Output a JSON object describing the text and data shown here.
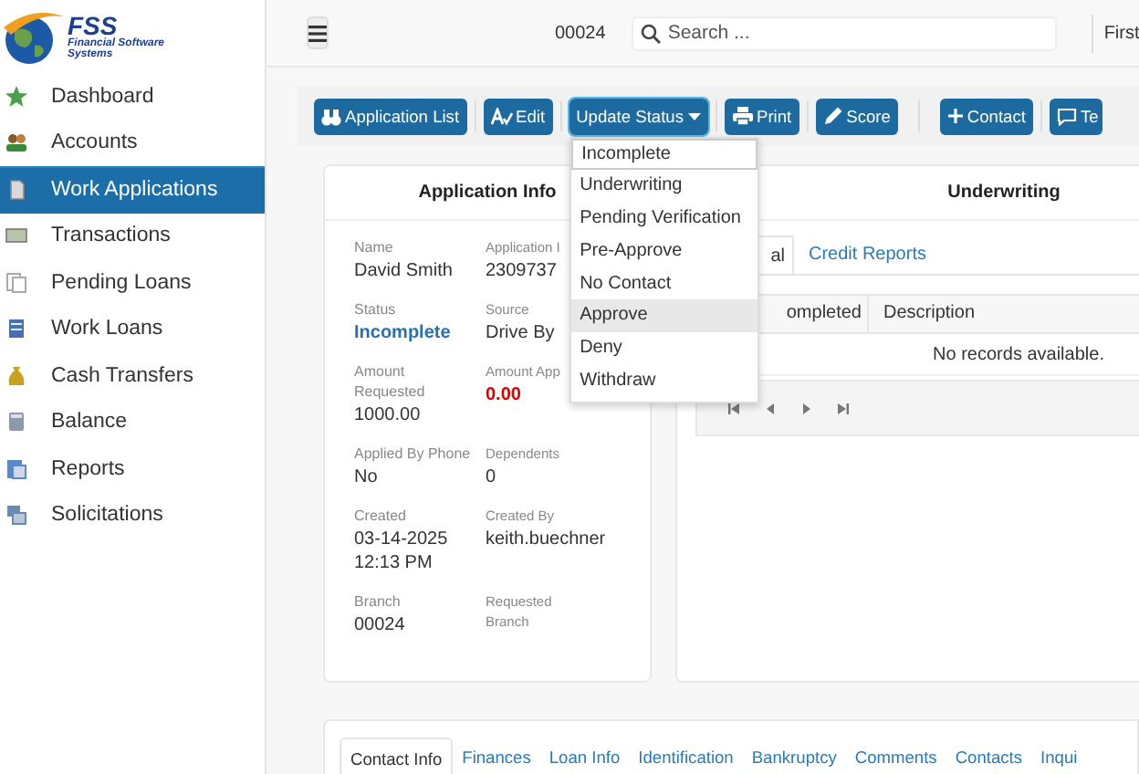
{
  "logo": {
    "title": "FSS",
    "subtitle": "Financial Software Systems"
  },
  "sidebar": {
    "items": [
      {
        "label": "Dashboard",
        "selected": false
      },
      {
        "label": "Accounts",
        "selected": false
      },
      {
        "label": "Work Applications",
        "selected": true
      },
      {
        "label": "Transactions",
        "selected": false
      },
      {
        "label": "Pending Loans",
        "selected": false
      },
      {
        "label": "Work Loans",
        "selected": false
      },
      {
        "label": "Cash Transfers",
        "selected": false
      },
      {
        "label": "Balance",
        "selected": false
      },
      {
        "label": "Reports",
        "selected": false
      },
      {
        "label": "Solicitations",
        "selected": false
      }
    ]
  },
  "top_bar": {
    "branch": "00024",
    "search": {
      "placeholder": "Search ..."
    },
    "user_field": "First"
  },
  "toolbar": {
    "buttons": [
      {
        "label": "Application List",
        "kind": "binoculars"
      },
      {
        "label": "Edit",
        "kind": "spell"
      },
      {
        "label": "Update Status",
        "kind": "dropdown"
      },
      {
        "label": "Print",
        "kind": "printer"
      },
      {
        "label": "Score",
        "kind": "pencil"
      },
      {
        "label": "Contact",
        "kind": "plus"
      },
      {
        "label": "Te",
        "kind": "message"
      }
    ]
  },
  "status_menu": {
    "items": [
      {
        "label": "Incomplete",
        "current": true,
        "highlighted": false
      },
      {
        "label": "Underwriting",
        "current": false,
        "highlighted": false
      },
      {
        "label": "Pending Verification",
        "current": false,
        "highlighted": false
      },
      {
        "label": "Pre-Approve",
        "current": false,
        "highlighted": false
      },
      {
        "label": "No Contact",
        "current": false,
        "highlighted": false
      },
      {
        "label": "Approve",
        "current": false,
        "highlighted": true
      },
      {
        "label": "Deny",
        "current": false,
        "highlighted": false
      },
      {
        "label": "Withdraw",
        "current": false,
        "highlighted": false
      }
    ]
  },
  "application_info": {
    "title": "Application Info",
    "fields": [
      {
        "label": "Name",
        "value": "David Smith",
        "kind": "plain"
      },
      {
        "label": "Application I",
        "value": "2309737",
        "kind": "plain"
      },
      {
        "label": "Status",
        "value": "Incomplete",
        "kind": "link"
      },
      {
        "label": "Source",
        "value": "Drive By",
        "kind": "plain"
      },
      {
        "label": "Amount Requested",
        "value": "1000.00",
        "kind": "plain"
      },
      {
        "label": "Amount App",
        "value": "0.00",
        "kind": "alert"
      },
      {
        "label": "Applied By Phone",
        "value": "No",
        "kind": "plain"
      },
      {
        "label": "Dependents",
        "value": "0",
        "kind": "plain"
      },
      {
        "label": "Created",
        "value": "03-14-2025 12:13 PM",
        "kind": "plain"
      },
      {
        "label": "Created By",
        "value": "keith.buechner",
        "kind": "plain"
      },
      {
        "label": "Branch",
        "value": "00024",
        "kind": "plain"
      },
      {
        "label": "Requested Branch"
      }
    ]
  },
  "underwriting": {
    "title": "Underwriting",
    "tabs": [
      {
        "label": "al",
        "selected": true
      },
      {
        "label": "Credit Reports",
        "selected": false
      }
    ],
    "table": {
      "columns": [
        "ompleted",
        "Description"
      ],
      "empty_message": "No records available."
    }
  },
  "detail_tabs": [
    {
      "label": "Contact Info",
      "selected": true
    },
    {
      "label": "Finances",
      "selected": false
    },
    {
      "label": "Loan Info",
      "selected": false
    },
    {
      "label": "Identification",
      "selected": false
    },
    {
      "label": "Bankruptcy",
      "selected": false
    },
    {
      "label": "Comments",
      "selected": false
    },
    {
      "label": "Contacts",
      "selected": false
    },
    {
      "label": "Inqui",
      "selected": false
    }
  ]
}
